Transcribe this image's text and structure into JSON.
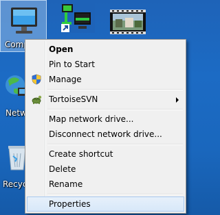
{
  "desktop": {
    "icons": [
      {
        "label": "Comp",
        "icon": "computer-icon"
      },
      {
        "label": "Netw",
        "icon": "network-icon"
      },
      {
        "label": "Recyc",
        "icon": "recycle-bin-icon"
      }
    ],
    "top_icons": [
      {
        "icon": "network-monitor-shortcut-icon"
      },
      {
        "icon": "video-thumbnail-icon"
      }
    ]
  },
  "context_menu": {
    "items": [
      {
        "label": "Open",
        "bold": true
      },
      {
        "label": "Pin to Start"
      },
      {
        "label": "Manage",
        "icon": "shield-icon"
      },
      {
        "label": "TortoiseSVN",
        "icon": "tortoisesvn-icon",
        "submenu": true
      },
      {
        "label": "Map network drive..."
      },
      {
        "label": "Disconnect network drive..."
      },
      {
        "label": "Create shortcut"
      },
      {
        "label": "Delete"
      },
      {
        "label": "Rename"
      },
      {
        "label": "Properties",
        "highlighted": true
      }
    ]
  },
  "colors": {
    "desktop_bg": "#1a67bd",
    "menu_bg": "#f0f0f0",
    "highlight_bg": "#dce9f9",
    "highlight_border": "#a8c9ef"
  }
}
